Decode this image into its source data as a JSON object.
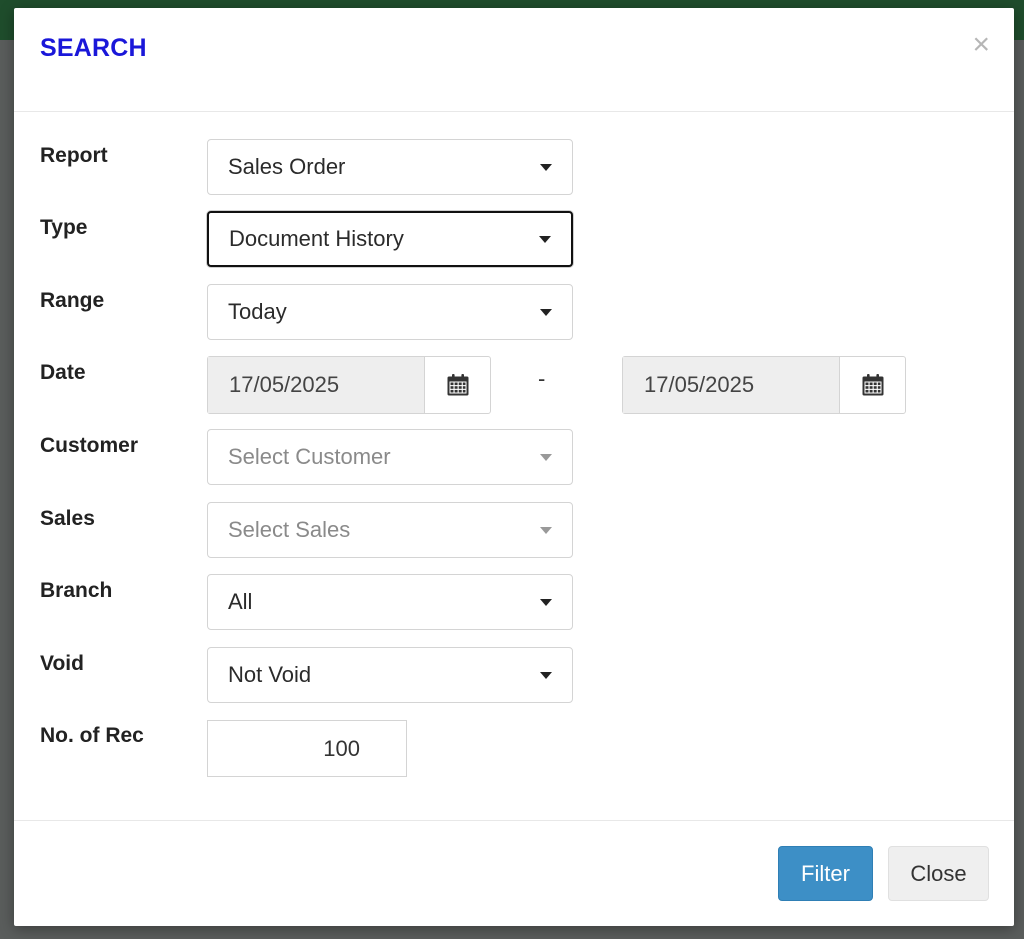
{
  "dialog": {
    "title": "SEARCH",
    "close_glyph": "×"
  },
  "form": {
    "report": {
      "label": "Report",
      "value": "Sales Order"
    },
    "type": {
      "label": "Type",
      "value": "Document History"
    },
    "range": {
      "label": "Range",
      "value": "Today"
    },
    "date": {
      "label": "Date",
      "from": "17/05/2025",
      "separator": "-",
      "to": "17/05/2025"
    },
    "customer": {
      "label": "Customer",
      "placeholder": "Select Customer"
    },
    "sales": {
      "label": "Sales",
      "placeholder": "Select Sales"
    },
    "branch": {
      "label": "Branch",
      "value": "All"
    },
    "void": {
      "label": "Void",
      "value": "Not Void"
    },
    "records": {
      "label": "No. of Rec",
      "value": "100"
    }
  },
  "footer": {
    "filter_label": "Filter",
    "close_label": "Close"
  },
  "icons": {
    "calendar": "calendar-icon",
    "dropdown": "caret-down-icon",
    "close": "close-icon"
  },
  "colors": {
    "title": "#1a17d9",
    "primary_button": "#3d8fc6",
    "top_bar": "#1f4d2c"
  }
}
